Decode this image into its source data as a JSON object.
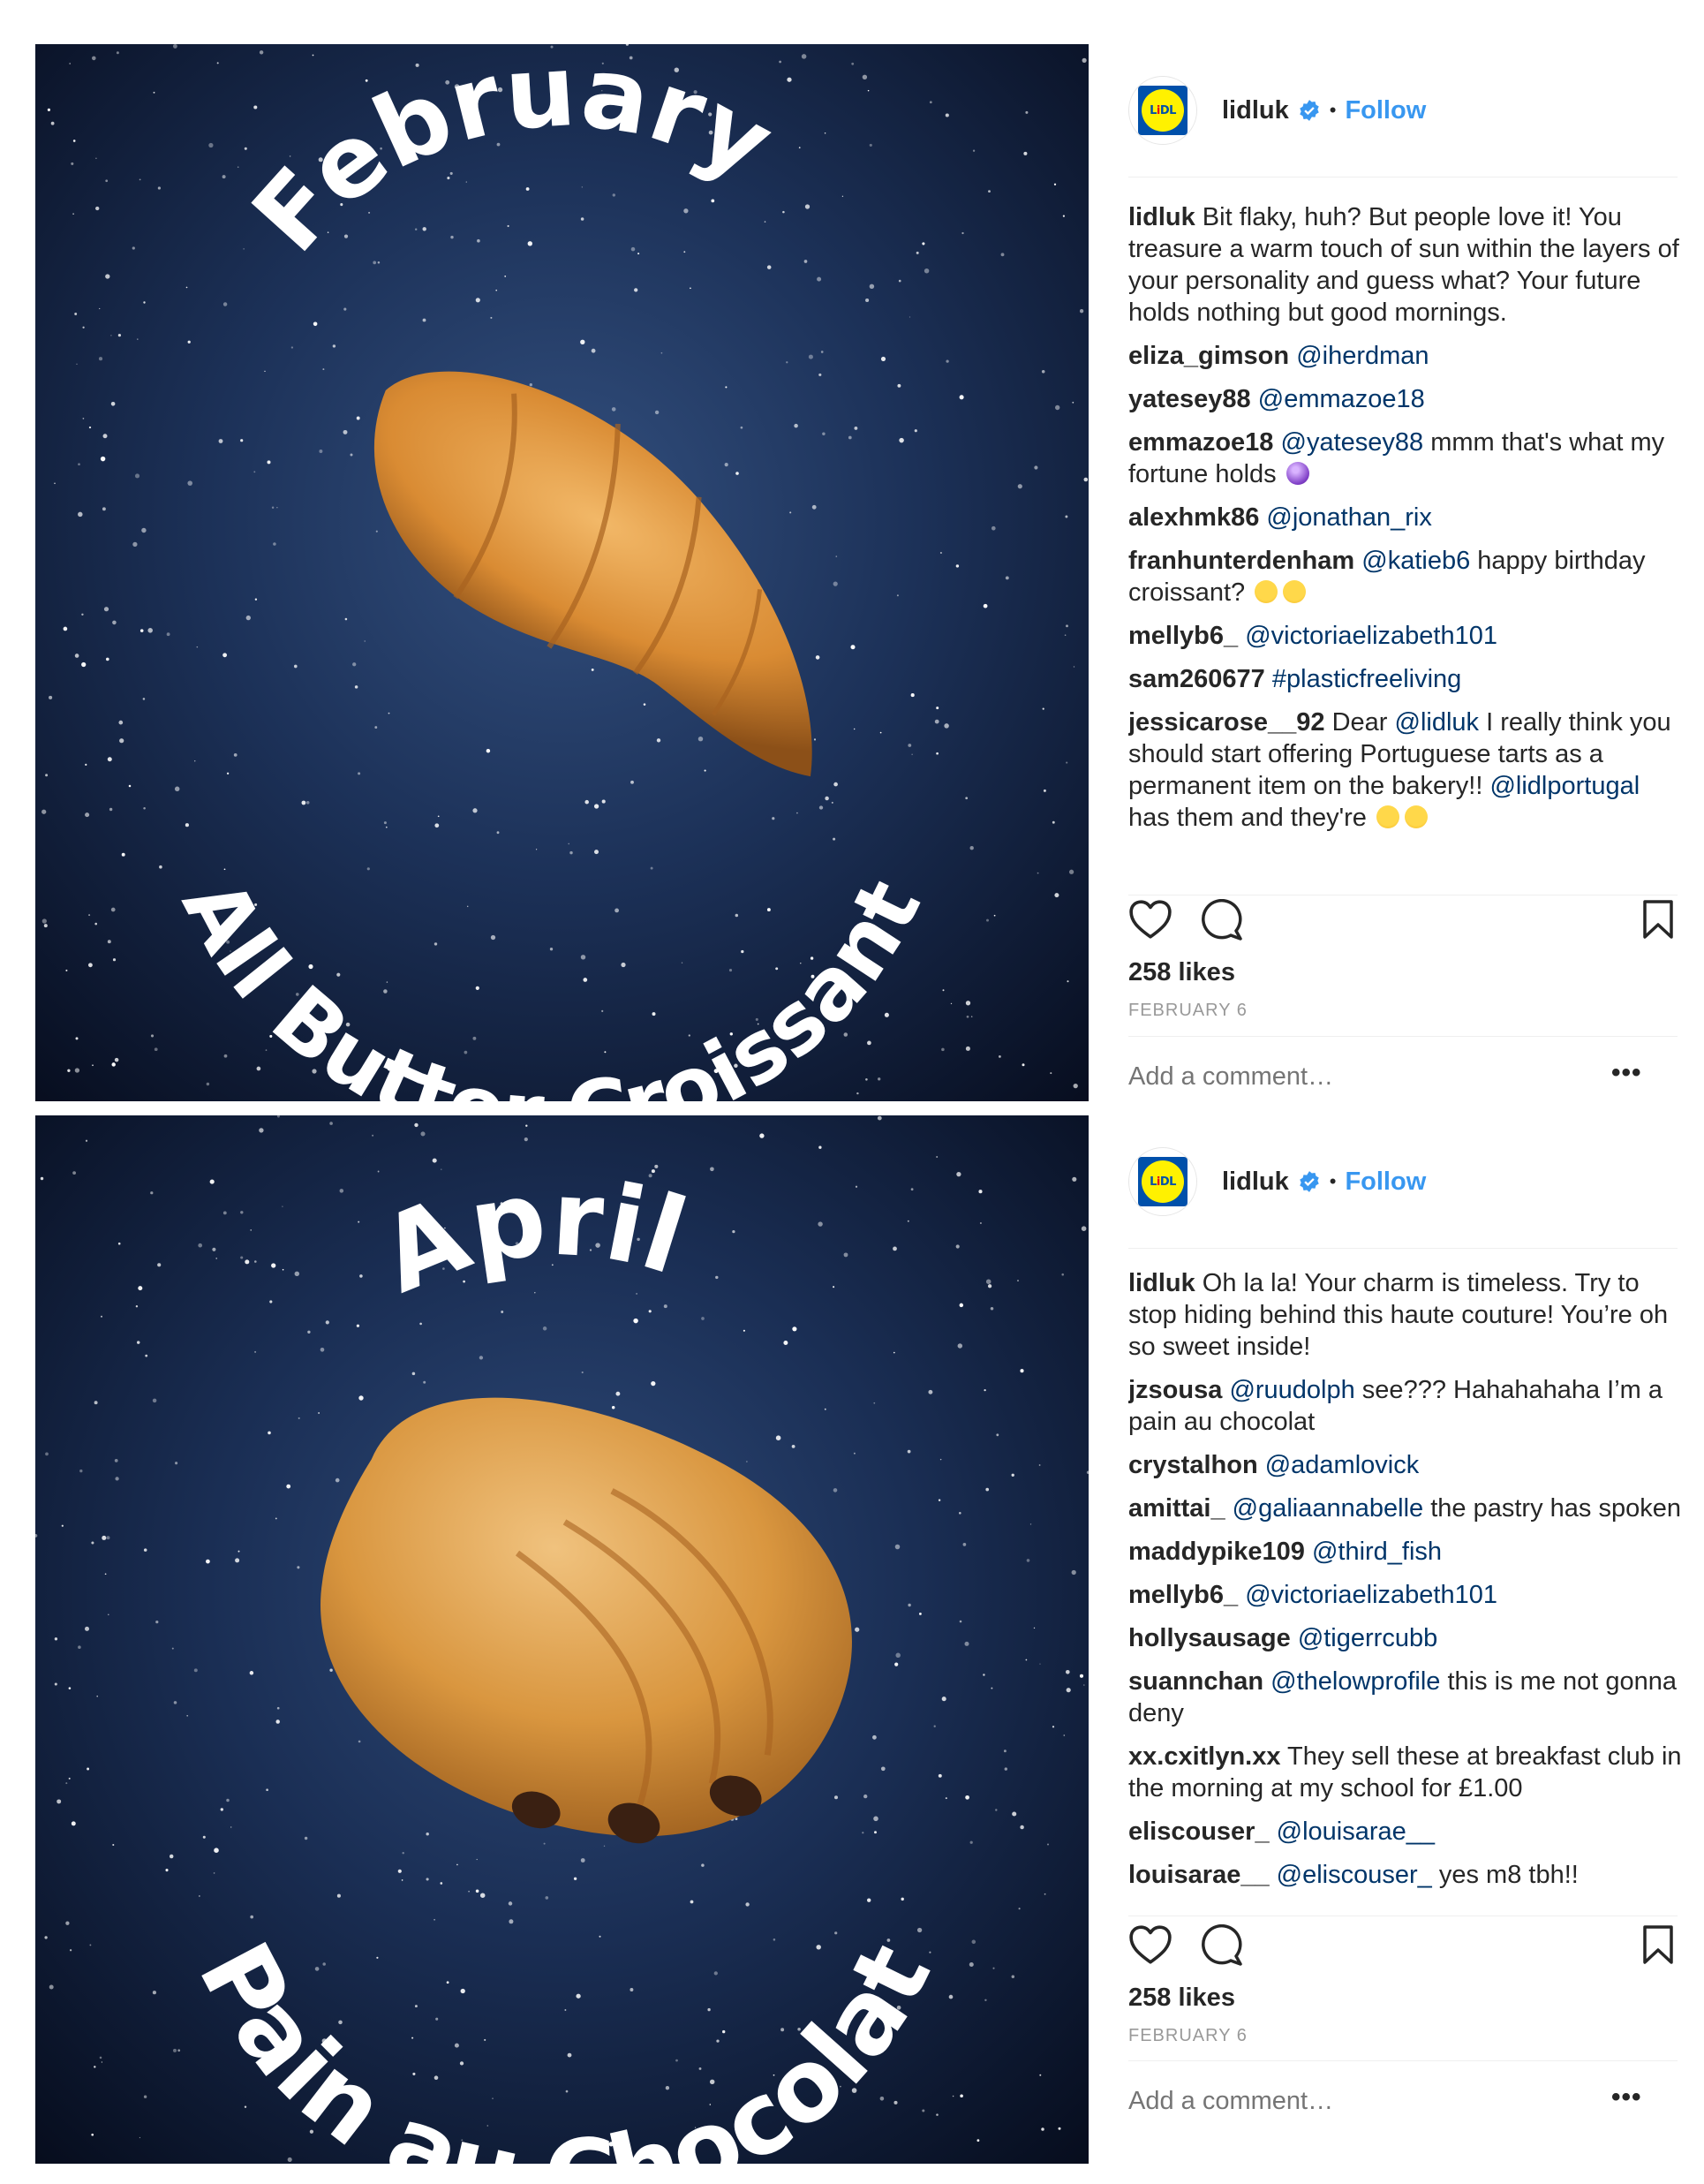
{
  "posts": [
    {
      "image": {
        "top_text": "February",
        "bottom_text": "All Butter Croissant",
        "subject": "croissant"
      },
      "account": {
        "username": "lidluk",
        "follow_label": "Follow",
        "separator": "•"
      },
      "comments": [
        {
          "user": "lidluk",
          "text": " Bit flaky, huh? But people love it! You treasure a warm touch of sun within the layers of your personality and guess what? Your future holds nothing but good mornings."
        },
        {
          "user": "eliza_gimson",
          "mention": "@iherdman",
          "text": ""
        },
        {
          "user": "yatesey88",
          "mention": "@emmazoe18",
          "text": ""
        },
        {
          "user": "emmazoe18",
          "mention": "@yatesey88",
          "text": " mmm that's what my fortune holds"
        },
        {
          "user": "alexhmk86",
          "mention": "@jonathan_rix",
          "text": ""
        },
        {
          "user": "franhunterdenham",
          "mention": "@katieb6",
          "text": " happy birthday croissant?"
        },
        {
          "user": "mellyb6_",
          "mention": "@victoriaelizabeth101",
          "text": ""
        },
        {
          "user": "sam260677",
          "mention": "#plasticfreeliving",
          "text": ""
        },
        {
          "user": "jessicarose__92",
          "text": " Dear ",
          "mention": "@lidluk",
          "text2": " I really think you should start offering Portuguese tarts as a permanent item on the bakery!!",
          "mention2": "@lidlportugal",
          "text3": " has them and they're"
        }
      ],
      "likes": "258 likes",
      "date": "FEBRUARY 6",
      "add_comment_placeholder": "Add a comment…",
      "more_label": "•••"
    },
    {
      "image": {
        "top_text": "April",
        "bottom_text": "Pain au Chocolat",
        "subject": "pain-au-chocolat"
      },
      "account": {
        "username": "lidluk",
        "follow_label": "Follow",
        "separator": "•"
      },
      "comments": [
        {
          "user": "lidluk",
          "text": " Oh la la! Your charm is timeless. Try to stop hiding behind this haute couture! You’re oh so sweet inside!"
        },
        {
          "user": "jzsousa",
          "mention": "@ruudolph",
          "text": " see??? Hahahahaha I’m a pain au chocolat"
        },
        {
          "user": "crystalhon",
          "mention": "@adamlovick",
          "text": ""
        },
        {
          "user": "amittai_",
          "mention": "@galiaannabelle",
          "text": " the pastry has spoken"
        },
        {
          "user": "maddypike109",
          "mention": "@third_fish",
          "text": ""
        },
        {
          "user": "mellyb6_",
          "mention": "@victoriaelizabeth101",
          "text": ""
        },
        {
          "user": "hollysausage",
          "mention": "@tigerrcubb",
          "text": ""
        },
        {
          "user": "suannchan",
          "mention": "@thelowprofile",
          "text": " this is me not gonna deny"
        },
        {
          "user": "xx.cxitlyn.xx",
          "text": " They sell these at breakfast club in the morning at my school for £1.00"
        },
        {
          "user": "eliscouser_",
          "mention": "@louisarae__",
          "text": ""
        },
        {
          "user": "louisarae__",
          "mention": "@eliscouser_",
          "text": " yes m8 tbh!!"
        }
      ],
      "likes": "258 likes",
      "date": "FEBRUARY 6",
      "add_comment_placeholder": "Add a comment…",
      "more_label": "•••"
    }
  ],
  "icons": {
    "like": "heart-icon",
    "comment": "speech-bubble-icon",
    "save": "bookmark-icon",
    "verified": "verified-badge-icon"
  },
  "colors": {
    "link": "#003569",
    "follow": "#3897f0",
    "muted": "#999999",
    "text": "#262626",
    "lidl_blue": "#0050aa",
    "lidl_yellow": "#fff100",
    "lidl_red": "#e60a14"
  }
}
